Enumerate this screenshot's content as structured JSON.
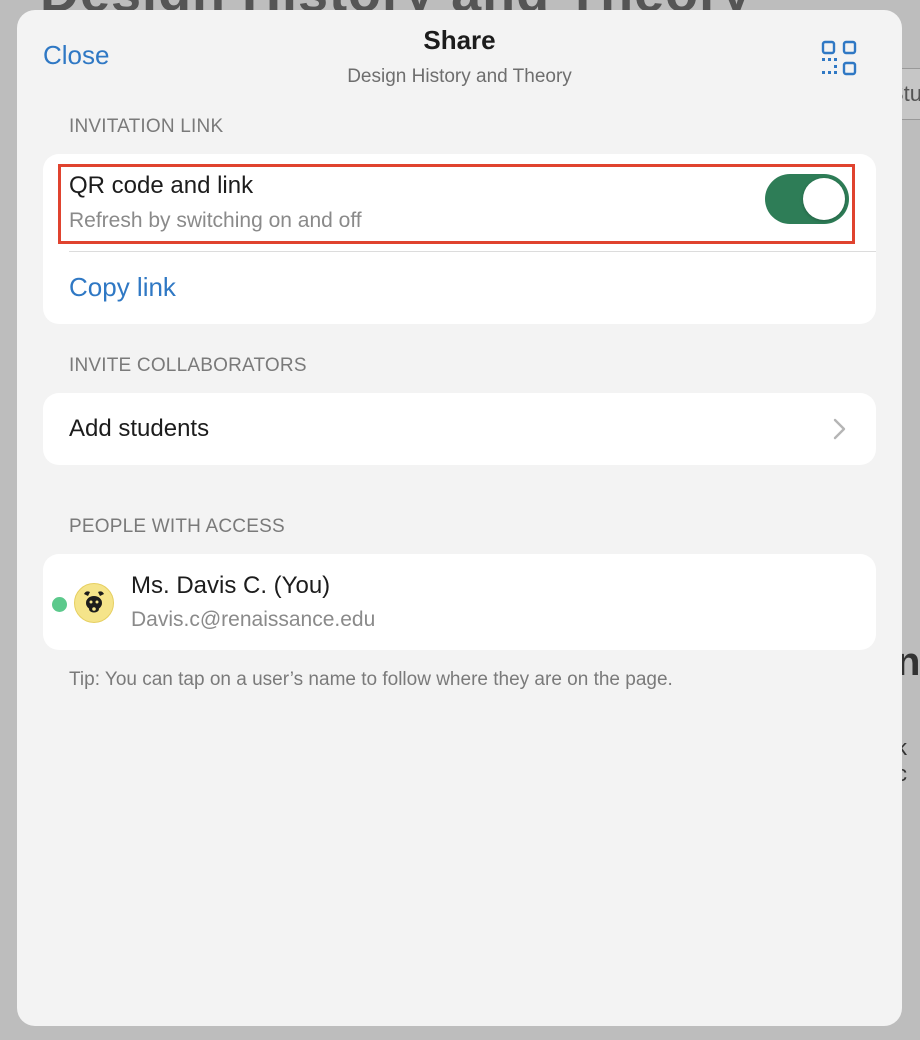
{
  "background": {
    "doc_title": "Design History and Theory",
    "tab_fragment": "Stu"
  },
  "header": {
    "close_label": "Close",
    "title": "Share",
    "subtitle": "Design History and Theory",
    "qr_icon": "qr-code-icon"
  },
  "invitation": {
    "section_label": "INVITATION LINK",
    "qr_title": "QR code and link",
    "qr_subtitle": "Refresh by switching on and off",
    "toggle_on": true,
    "copy_link_label": "Copy link"
  },
  "collaborators": {
    "section_label": "INVITE COLLABORATORS",
    "add_students_label": "Add students"
  },
  "access": {
    "section_label": "PEOPLE WITH ACCESS",
    "people": [
      {
        "name": "Ms. Davis C. (You)",
        "email": "Davis.c@renaissance.edu",
        "online": true,
        "avatar_icon": "bull-avatar-icon"
      }
    ]
  },
  "tip": "Tip: You can tap on a user’s name to follow where they are on the page.",
  "colors": {
    "accent": "#2f78c4",
    "toggle_on": "#2e7d57",
    "highlight": "#e0432f",
    "presence": "#5cc98c"
  }
}
